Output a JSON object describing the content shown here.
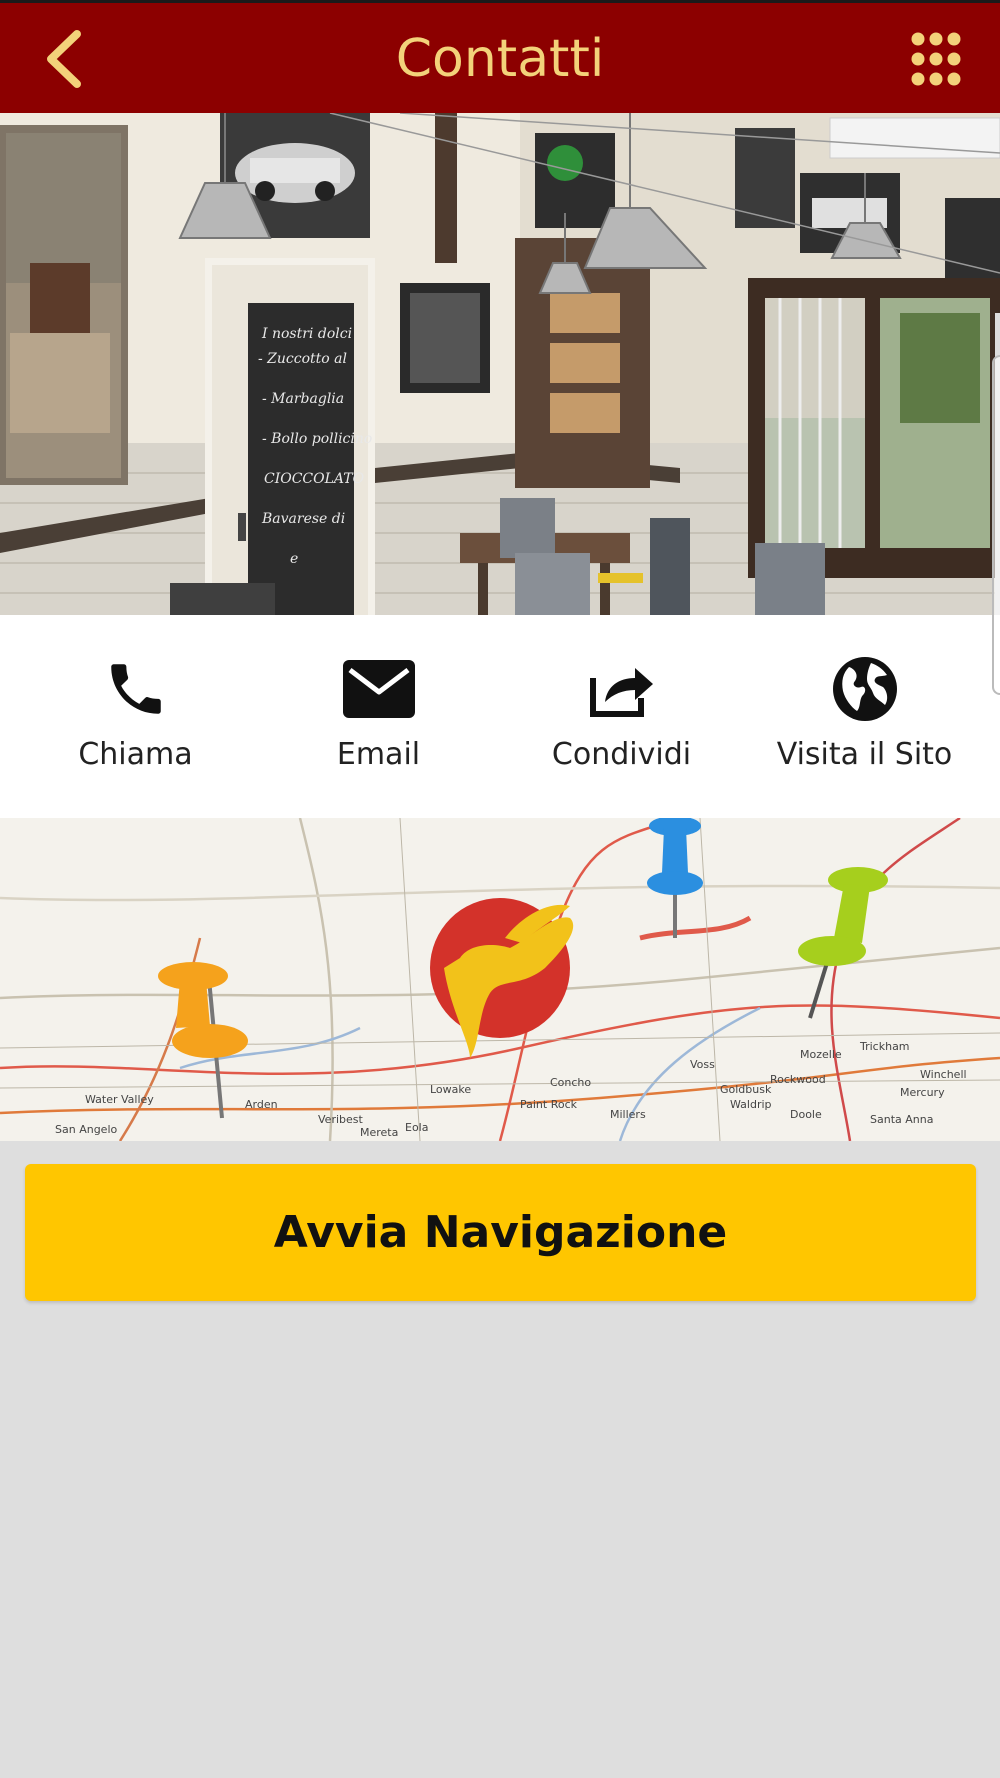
{
  "header": {
    "title": "Contatti",
    "back_icon": "chevron-left-icon",
    "menu_icon": "grid-menu-icon",
    "background_color": "#8c0000",
    "title_color": "#f3d27a"
  },
  "hero": {
    "chalkboard_lines": [
      "I nostri dolci",
      "- Zuccotto al cioccolato",
      "- Marbaglia ...",
      "- Bollo pollicino ...",
      "CIOCCOLATO",
      "Bavarese di frutta",
      "e"
    ]
  },
  "actions": [
    {
      "label": "Chiama",
      "icon": "phone-icon"
    },
    {
      "label": "Email",
      "icon": "envelope-icon"
    },
    {
      "label": "Condividi",
      "icon": "share-icon"
    },
    {
      "label": "Visita il Sito",
      "icon": "globe-icon"
    }
  ],
  "map": {
    "logo_icon": "hands-logo-icon",
    "place_labels": [
      "Water Valley",
      "Arden",
      "San Angelo",
      "Veribest",
      "Mereta",
      "Eola",
      "Lowake",
      "Paint Rock",
      "Concho",
      "Millers",
      "Voss",
      "Goldbusk",
      "Rockwood",
      "Waldrip",
      "Doole",
      "Mozelle",
      "Winchell",
      "Mercury",
      "Trickham",
      "Santa Anna"
    ],
    "pin_colors": [
      "#f5a21c",
      "#2b8fe0",
      "#a6cf1d"
    ]
  },
  "navigation_button": {
    "label": "Avvia Navigazione",
    "color": "#ffc600"
  }
}
